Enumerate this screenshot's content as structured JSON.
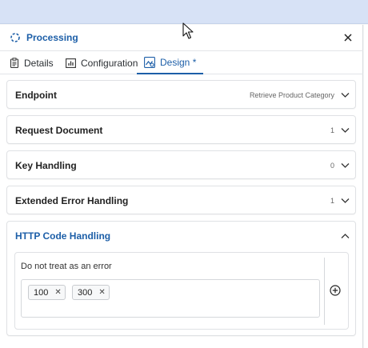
{
  "header": {
    "title": "Processing"
  },
  "tabs": [
    {
      "label": "Details",
      "icon": "clipboard-icon"
    },
    {
      "label": "Configuration",
      "icon": "bar-chart-icon"
    },
    {
      "label": "Design *",
      "icon": "design-icon",
      "active": true
    }
  ],
  "sections": [
    {
      "title": "Endpoint",
      "value": "Retrieve Product Category",
      "expanded": false
    },
    {
      "title": "Request Document",
      "value": "1",
      "expanded": false
    },
    {
      "title": "Key Handling",
      "value": "0",
      "expanded": false
    },
    {
      "title": "Extended Error Handling",
      "value": "1",
      "expanded": false
    },
    {
      "title": "HTTP Code Handling",
      "expanded": true,
      "inner_label": "Do not treat as an error",
      "tokens": [
        "100",
        "300"
      ]
    }
  ],
  "colors": {
    "accent": "#1d5fa8",
    "topband": "#d7e2f6"
  }
}
